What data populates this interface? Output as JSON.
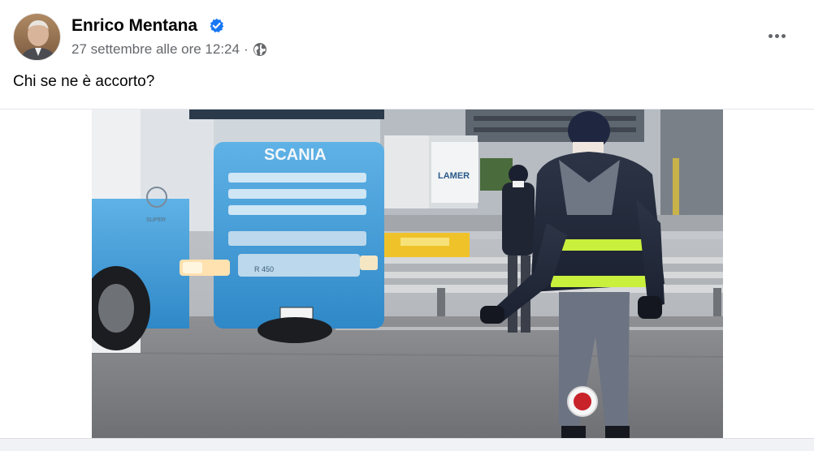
{
  "post": {
    "author": "Enrico Mentana",
    "timestamp": "27 settembre alle ore 12:24",
    "separator": "·",
    "privacy_icon": "globe-icon",
    "verified_icon": "verified-badge-icon",
    "more_icon": "more-options-icon",
    "text": "Chi se ne è accorto?"
  },
  "photo": {
    "truck_brand": "SCANIA",
    "truck_model": "R 450",
    "truck_badge": "SUPER",
    "trailer_logo": "LAMER"
  },
  "colors": {
    "name": "#050505",
    "meta": "#65676b",
    "verified": "#1877f2",
    "truck": "#3a9bd9",
    "vest_stripe": "#c8f03c",
    "page_bg": "#f0f2f5"
  }
}
